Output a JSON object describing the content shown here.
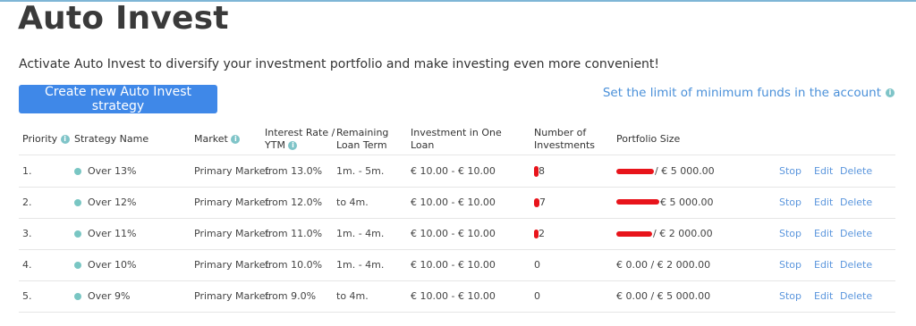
{
  "page": {
    "title": "Auto Invest",
    "subtitle": "Activate Auto Invest to diversify your investment portfolio and make investing even more convenient!",
    "create_button": "Create new Auto Invest strategy",
    "limit_link": "Set the limit of minimum funds in the account"
  },
  "table": {
    "headers": {
      "priority": "Priority",
      "strategy": "Strategy Name",
      "market": "Market",
      "interest_line1": "Interest Rate /",
      "interest_line2": "YTM",
      "remaining_line1": "Remaining",
      "remaining_line2": "Loan Term",
      "investment_line1": "Investment in One",
      "investment_line2": "Loan",
      "number_line1": "Number of",
      "number_line2": "Investments",
      "portfolio": "Portfolio Size"
    },
    "rows": [
      {
        "priority": "1.",
        "strategy": "Over 13%",
        "market": "Primary Market",
        "interest": "from 13.0%",
        "term": "1m. - 5m.",
        "investment": "€ 10.00 - € 10.00",
        "number": "8",
        "portfolio": "/ € 5 000.00",
        "stop": "Stop",
        "edit": "Edit",
        "delete": "Delete"
      },
      {
        "priority": "2.",
        "strategy": "Over 12%",
        "market": "Primary Market",
        "interest": "from 12.0%",
        "term": "to 4m.",
        "investment": "€ 10.00 - € 10.00",
        "number": "7",
        "portfolio": "€ 5 000.00",
        "stop": "Stop",
        "edit": "Edit",
        "delete": "Delete"
      },
      {
        "priority": "3.",
        "strategy": "Over 11%",
        "market": "Primary Market",
        "interest": "from 11.0%",
        "term": "1m. - 4m.",
        "investment": "€ 10.00 - € 10.00",
        "number": "2",
        "portfolio": "/ € 2 000.00",
        "stop": "Stop",
        "edit": "Edit",
        "delete": "Delete"
      },
      {
        "priority": "4.",
        "strategy": "Over 10%",
        "market": "Primary Market",
        "interest": "from 10.0%",
        "term": "1m. - 4m.",
        "investment": "€ 10.00 - € 10.00",
        "number": "0",
        "portfolio": "€ 0.00 / € 2 000.00",
        "stop": "Stop",
        "edit": "Edit",
        "delete": "Delete"
      },
      {
        "priority": "5.",
        "strategy": "Over 9%",
        "market": "Primary Market",
        "interest": "from 9.0%",
        "term": "to 4m.",
        "investment": "€ 10.00 - € 10.00",
        "number": "0",
        "portfolio": "€ 0.00 / € 5 000.00",
        "stop": "Stop",
        "edit": "Edit",
        "delete": "Delete"
      }
    ]
  },
  "icons": {
    "info": "info-icon",
    "status_dot": "status-dot-icon"
  },
  "colors": {
    "primary": "#3f88e8",
    "link": "#4a90d9",
    "status_dot": "#79c6c3",
    "redaction": "#e8141b"
  }
}
